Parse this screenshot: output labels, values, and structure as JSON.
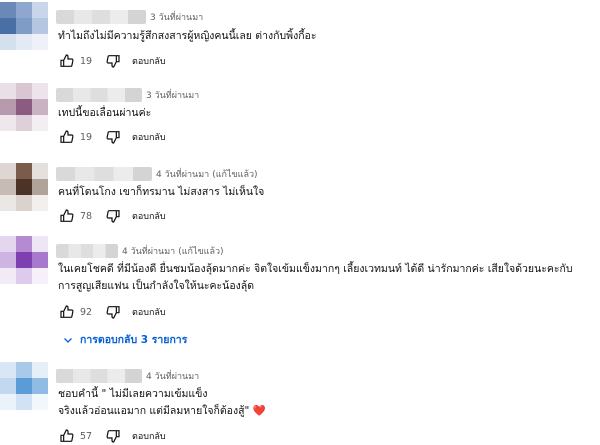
{
  "labels": {
    "reply": "ตอบกลับ",
    "edited": "(แก้ไขแล้ว)"
  },
  "comments": [
    {
      "time": "3 วันที่ผ่านมา",
      "text_lines": [
        "ทำไมถึงไม่มีความรู้สึกสงสารผู้หญิงคนนี้เลย ต่างกับพิ้งกี้อะ"
      ],
      "likes": "19",
      "edited": false
    },
    {
      "time": "3 วันที่ผ่านมา",
      "text_lines": [
        "เทปนี้ขอเลื่อนผ่านค่ะ"
      ],
      "likes": "19",
      "edited": false
    },
    {
      "time": "4 วันที่ผ่านมา",
      "text_lines": [
        "คนที่โดนโกง เขาก็ทรมาน ไม่สงสาร ไม่เห็นใจ"
      ],
      "likes": "78",
      "edited": true
    },
    {
      "time": "4 วันที่ผ่านมา",
      "text_lines": [
        "ในเคยโชคดี ที่มีน้องดี ยื่นชมน้องลุ้ดมากค่ะ จิตใจเข้มแข็งมากๆ เลี้ยงเวทมนท์ ได้ดี น่ารักมากค่ะ เสียใจด้วยนะคะกับ",
        "การสูญเสียแฟน เป็นกำลังใจให้นะคะน้องลุ้ด"
      ],
      "likes": "92",
      "edited": true,
      "replies_label": "การตอบกลับ 3 รายการ"
    },
    {
      "time": "4 วันที่ผ่านมา",
      "text_lines": [
        "ชอบคำนี้ \" ไม่มีเลยความเข้มแข็ง",
        "จริงแล้วอ่อนแอมาก แต่มีลมหายใจก็ต้องสู้\""
      ],
      "heart": "❤️",
      "likes": "57",
      "edited": false
    }
  ],
  "colors": {
    "reply_link": "#065fd4",
    "meta_gray": "#606060"
  },
  "icons": [
    "thumb-up-icon",
    "thumb-down-icon",
    "chevron-down-icon",
    "heart-emoji"
  ]
}
